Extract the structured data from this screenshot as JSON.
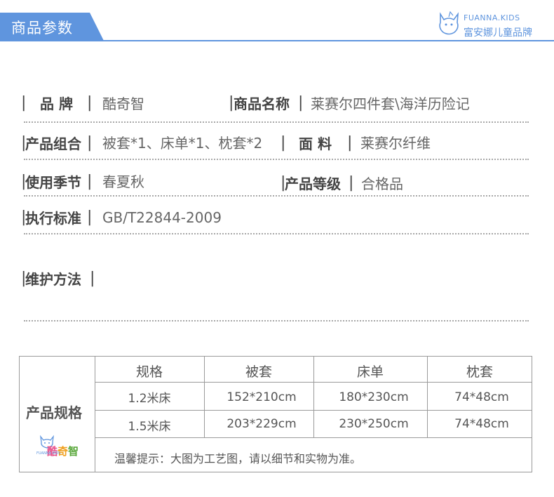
{
  "header": {
    "title": "商品参数",
    "brand_en": "FUANNA.KIDS",
    "brand_cn": "富安娜儿童品牌",
    "accent_color": "#5f95de"
  },
  "params": {
    "brand_label": "品 牌",
    "brand_value": "酷奇智",
    "name_label": "商品名称",
    "name_value": "莱赛尔四件套\\海洋历险记",
    "combo_label": "产品组合",
    "combo_value": "被套*1、床单*1、枕套*2",
    "fabric_label": "面 料",
    "fabric_value": "莱赛尔纤维",
    "season_label": "使用季节",
    "season_value": "春夏秋",
    "grade_label": "产品等级",
    "grade_value": "合格品",
    "standard_label": "执行标准",
    "standard_value": "GB/T22844-2009",
    "care_label": "维护方法",
    "care_value": ""
  },
  "spec": {
    "title": "产品规格",
    "logo_text": "酷奇智",
    "logo_sub": "FUANNA KIDS",
    "columns": [
      "规格",
      "被套",
      "床单",
      "枕套"
    ],
    "rows": [
      [
        "1.2米床",
        "152*210cm",
        "180*230cm",
        "74*48cm"
      ],
      [
        "1.5米床",
        "203*229cm",
        "230*250cm",
        "74*48cm"
      ]
    ],
    "tip": "温馨提示：大图为工艺图，请以细节和实物为准。"
  }
}
